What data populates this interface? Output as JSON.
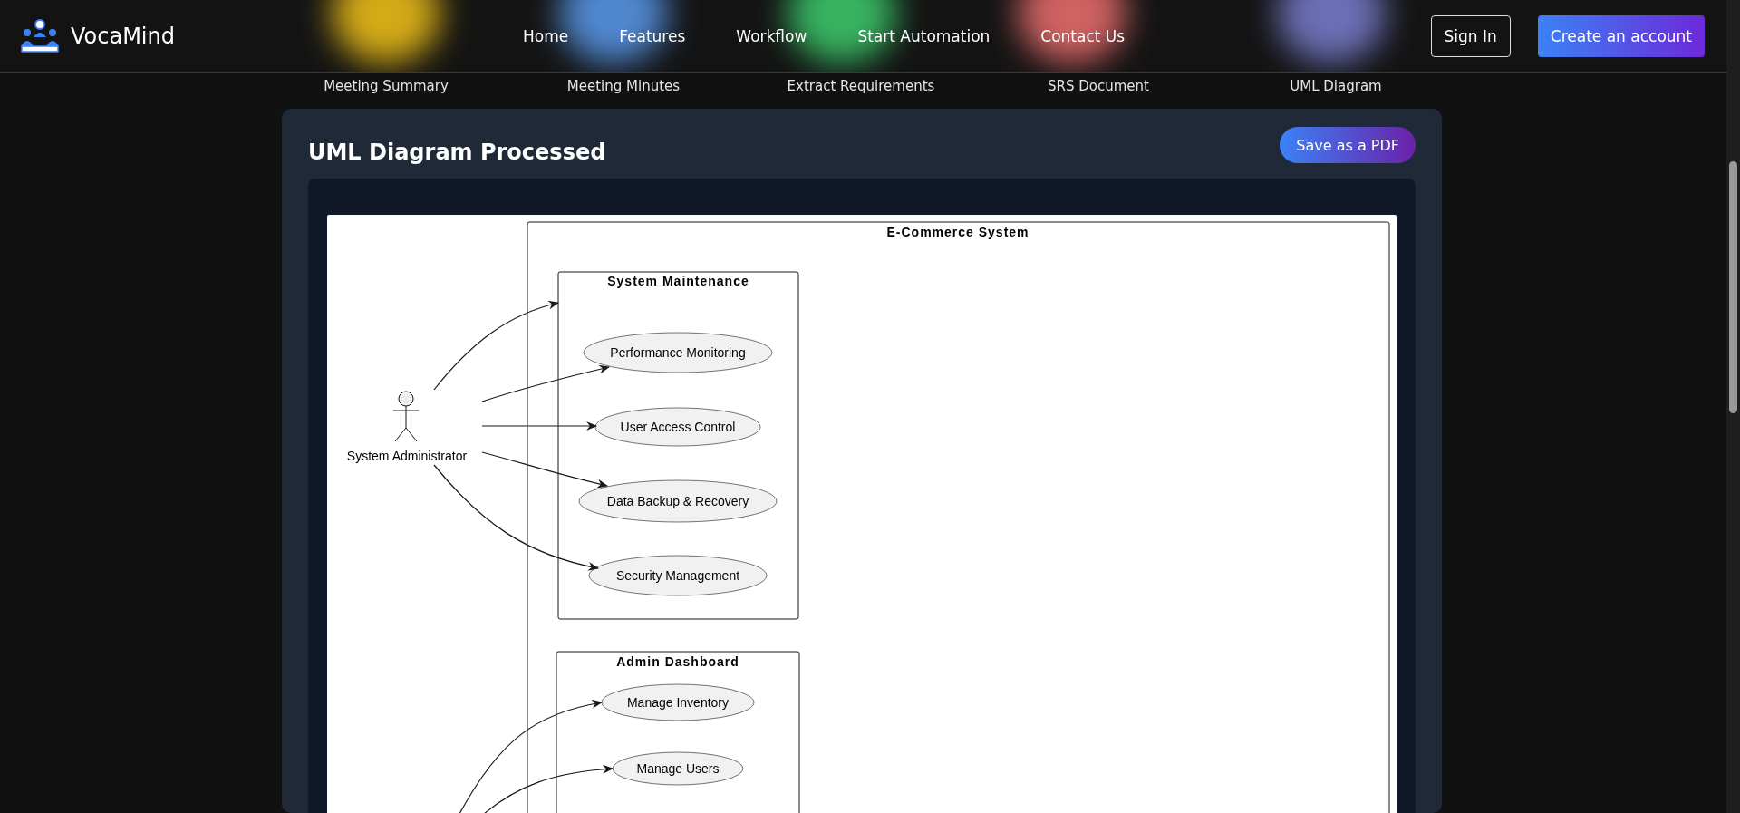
{
  "header": {
    "brand": "VocaMind",
    "nav": [
      "Home",
      "Features",
      "Workflow",
      "Start Automation",
      "Contact Us"
    ],
    "sign_in": "Sign In",
    "create_account": "Create an account"
  },
  "steps": [
    "Meeting Summary",
    "Meeting Minutes",
    "Extract Requirements",
    "SRS Document",
    "UML Diagram"
  ],
  "result": {
    "title": "UML Diagram Processed",
    "save_button": "Save as a PDF",
    "diagram": {
      "system": "E-Commerce System",
      "actor": "System Administrator",
      "packages": [
        {
          "title": "System Maintenance",
          "use_cases": [
            "Performance Monitoring",
            "User Access Control",
            "Data Backup & Recovery",
            "Security Management"
          ]
        },
        {
          "title": "Admin Dashboard",
          "use_cases": [
            "Manage Inventory",
            "Manage Users"
          ]
        }
      ]
    }
  }
}
